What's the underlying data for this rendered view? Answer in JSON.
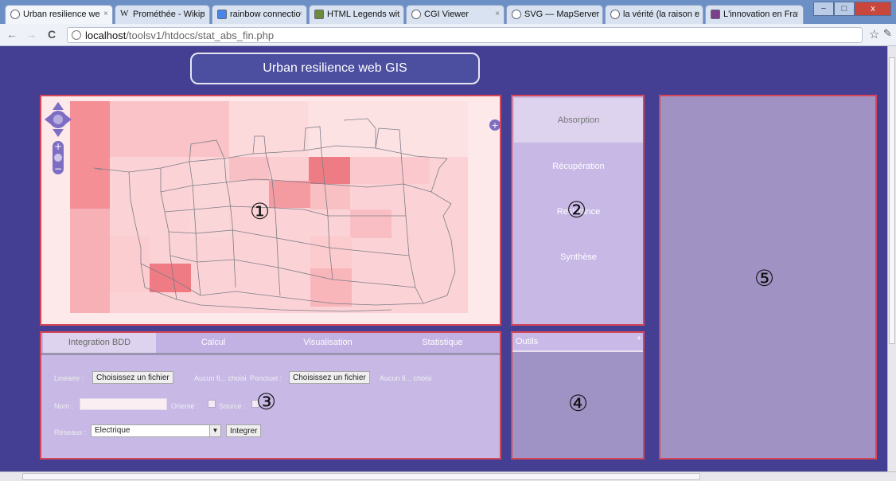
{
  "browser": {
    "tabs": [
      {
        "label": "Urban resilience we"
      },
      {
        "label": "Prométhée - Wikip"
      },
      {
        "label": "rainbow connectio"
      },
      {
        "label": "HTML Legends wit"
      },
      {
        "label": "CGI Viewer"
      },
      {
        "label": "SVG — MapServer"
      },
      {
        "label": "la vérité (la raison e"
      },
      {
        "label": "L'innovation en Fra"
      }
    ],
    "url_host": "localhost",
    "url_path": "/toolsv1/htdocs/stat_abs_fin.php",
    "back_icon": "back-arrow-icon",
    "forward_icon": "forward-arrow-icon",
    "reload_icon": "reload-icon",
    "bookmark_icon": "star-icon",
    "win_minimize": "−",
    "win_maximize": "□",
    "win_close": "x"
  },
  "app": {
    "title": "Urban resilience web GIS"
  },
  "panels": {
    "map_number": "①",
    "tabs_number": "②",
    "form_number": "③",
    "tools_number": "④",
    "wide_number": "⑤"
  },
  "side_tabs": [
    "Absorption",
    "Récupération",
    "Resistance",
    "Synthèse"
  ],
  "bottom_tabs": [
    "Integration BDD",
    "Calcul",
    "Visualisation",
    "Statistique"
  ],
  "form": {
    "lineaire_label": "Lineaire :",
    "ponctuel_label": "Ponctuel :",
    "choose_file": "Choisissez un fichier",
    "no_file_1": "Aucun fi... choisi",
    "no_file_2": "Aucun fi... choisi",
    "nom_label": "Nom :",
    "nom_value": "",
    "oriente_label": "Orienté :",
    "source_label": "Source :",
    "reseaux_label": "Réseaux :",
    "reseaux_selected": "Electrique",
    "integrer_button": "Integrer"
  },
  "tools": {
    "title": "Outils",
    "expand": "+"
  },
  "colors": {
    "background": "#453f93",
    "panel_border": "#d64656",
    "panel_lilac": "#c7b8e6",
    "panel_purple": "#a093c4",
    "map_light": "#fde9ea",
    "map_pink": "#f9c9cc",
    "map_red": "#ef8a90"
  }
}
